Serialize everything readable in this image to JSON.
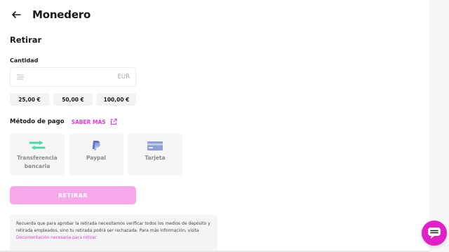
{
  "header": {
    "title": "Monedero",
    "back_icon": "arrow-left-icon"
  },
  "section": {
    "title": "Retirar"
  },
  "amount": {
    "label": "Cantidad",
    "value": "",
    "currency": "EUR",
    "icon": "money-icon"
  },
  "quick_amounts": [
    {
      "label": "25,00 €"
    },
    {
      "label": "50,00 €"
    },
    {
      "label": "100,00 €"
    }
  ],
  "payment": {
    "title": "Método de pago",
    "learn_more": "SABER MÁS",
    "methods": [
      {
        "label": "Transferencia bancaria",
        "icon": "bank-transfer-icon"
      },
      {
        "label": "Paypal",
        "icon": "paypal-icon"
      },
      {
        "label": "Tarjeta",
        "icon": "credit-card-icon"
      }
    ]
  },
  "withdraw_button": "RETIRAR",
  "notice": {
    "text": "Recuerda que para aprobar la retirada necesitamos verificar todos los medios de depósito y retirada empleados, sino tu retirada podrá ser rechazada. Para más información, visita",
    "link": "Documentación necesaria para retirar."
  },
  "colors": {
    "accent": "#e23ad0",
    "button_disabled": "#f7a8ea",
    "chat_fab": "#e021c8",
    "transfer_icon": "#4fd6a6",
    "paypal_icon": "#7a8fd9"
  }
}
